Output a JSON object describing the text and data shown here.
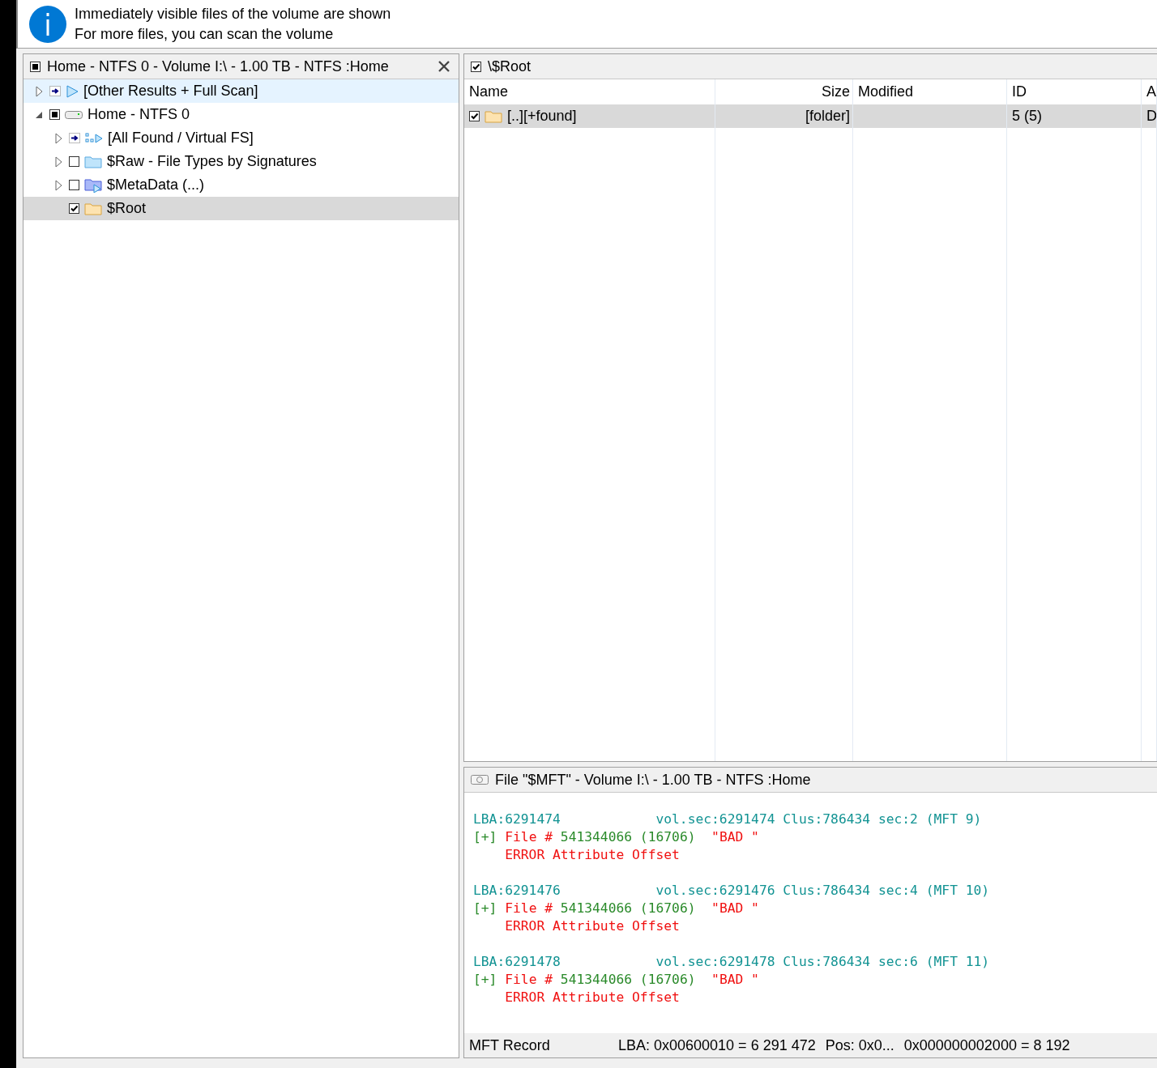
{
  "info_bar": {
    "lines": [
      "Immediately visible files of the volume are shown",
      "For more files, you can scan the volume"
    ]
  },
  "tree_panel": {
    "title": "Home - NTFS 0 - Volume I:\\ - 1.00 TB - NTFS :Home",
    "checked": false,
    "partial": true,
    "items": [
      {
        "label": "[Other Results + Full Scan]",
        "kind": "scan",
        "expanded": false,
        "hovered": true,
        "selected": false
      },
      {
        "label": "Home - NTFS 0",
        "kind": "drive",
        "checked": false,
        "partial": true,
        "expanded": true,
        "hovered": false,
        "selected": false,
        "children": [
          {
            "label": "[All Found / Virtual FS]",
            "kind": "virtual",
            "expanded": false,
            "hovered": false,
            "selected": false
          },
          {
            "label": "$Raw - File Types by Signatures",
            "kind": "raw",
            "checked": false,
            "partial": false,
            "expanded": false,
            "hovered": false,
            "selected": false
          },
          {
            "label": "$MetaData (...)",
            "kind": "meta",
            "checked": false,
            "partial": false,
            "expanded": false,
            "hovered": false,
            "selected": false
          },
          {
            "label": "$Root",
            "kind": "folder",
            "checked": true,
            "hovered": false,
            "selected": true
          }
        ]
      }
    ]
  },
  "file_list": {
    "title": "\\$Root",
    "checked": true,
    "columns": [
      {
        "label": "Name",
        "kind": "text"
      },
      {
        "label": "Size",
        "kind": "number"
      },
      {
        "label": "Modified",
        "kind": "text"
      },
      {
        "label": "ID",
        "kind": "text"
      },
      {
        "label": "A",
        "kind": "text"
      }
    ],
    "rows": [
      {
        "checked": true,
        "selected": true,
        "cells": [
          "[..][+found]",
          "[folder]",
          "",
          "5 (5)",
          "D"
        ]
      }
    ]
  },
  "record_panel": {
    "title": "File \"$MFT\" - Volume I:\\ - 1.00 TB - NTFS :Home",
    "records": [
      {
        "lba": "LBA:6291474",
        "location": "vol.sec:6291474 Clus:786434 sec:2 (MFT 9)",
        "expander": "[+]",
        "file": "File #",
        "number": "541344066 (16706)",
        "tag": "\"BAD \"",
        "error": "ERROR Attribute Offset"
      },
      {
        "lba": "LBA:6291476",
        "location": "vol.sec:6291476 Clus:786434 sec:4 (MFT 10)",
        "expander": "[+]",
        "file": "File #",
        "number": "541344066 (16706)",
        "tag": "\"BAD \"",
        "error": "ERROR Attribute Offset"
      },
      {
        "lba": "LBA:6291478",
        "location": "vol.sec:6291478 Clus:786434 sec:6 (MFT 11)",
        "expander": "[+]",
        "file": "File #",
        "number": "541344066 (16706)",
        "tag": "\"BAD \"",
        "error": "ERROR Attribute Offset"
      }
    ]
  },
  "status_bar": {
    "label": "MFT Record",
    "lba": "LBA: 0x00600010 = 6 291 472",
    "position": "Pos: 0x0...",
    "offset": "0x000000002000 = 8 192"
  }
}
